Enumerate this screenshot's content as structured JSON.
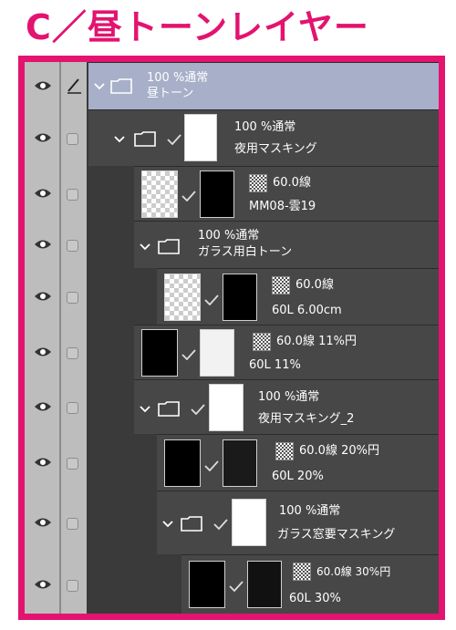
{
  "title": "C／昼トーンレイヤー",
  "layers": [
    {
      "line1": "100 %通常",
      "line2": "昼トーン"
    },
    {
      "line1": "100 %通常",
      "line2": "夜用マスキング"
    },
    {
      "line1": "60.0線",
      "line2": "MM08-雲19"
    },
    {
      "line1": "100 %通常",
      "line2": "ガラス用白トーン"
    },
    {
      "line1": "60.0線",
      "line2": "60L 6.00cm"
    },
    {
      "line1": "60.0線 11%円",
      "line2": "60L 11%"
    },
    {
      "line1": "100 %通常",
      "line2": "夜用マスキング_2"
    },
    {
      "line1": "60.0線 20%円",
      "line2": "60L 20%"
    },
    {
      "line1": "100 %通常",
      "line2": "ガラス窓要マスキング"
    },
    {
      "line1": "60.0線 30%円",
      "line2": "60L 30%"
    }
  ],
  "icons": [
    "eye-icon",
    "pen-icon",
    "chevron-down-icon",
    "folder-icon",
    "check-icon",
    "tone-icon"
  ]
}
